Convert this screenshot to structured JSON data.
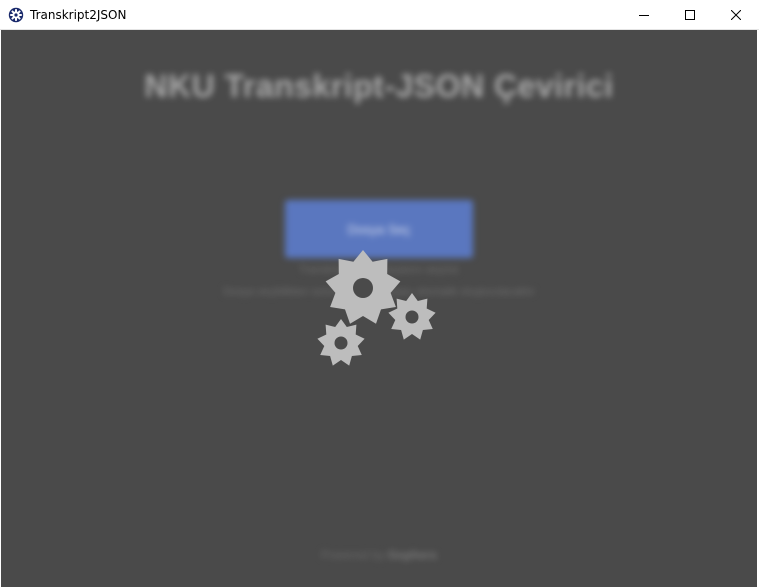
{
  "window": {
    "title": "Transkript2JSON",
    "icons": {
      "app": "gear-app-icon",
      "minimize": "minimize-icon",
      "maximize": "maximize-icon",
      "close": "close-icon"
    }
  },
  "main": {
    "heading": "NKU Transkript-JSON Çevirici",
    "primary_button_label": "Dosya Seç",
    "hint_line_1": "Transkript PDF dosyasını seçiniz",
    "hint_line_2": "Dosya seçildikten sonra JSON dosyası otomatik oluşturulacaktır",
    "footer_prefix": "Powered by",
    "footer_brand": "Gophers"
  },
  "overlay": {
    "state": "loading",
    "icon": "loading-gears-icon"
  },
  "colors": {
    "background": "#4a4a4a",
    "button": "#5a77bf",
    "gears": "#bdbdbd"
  }
}
